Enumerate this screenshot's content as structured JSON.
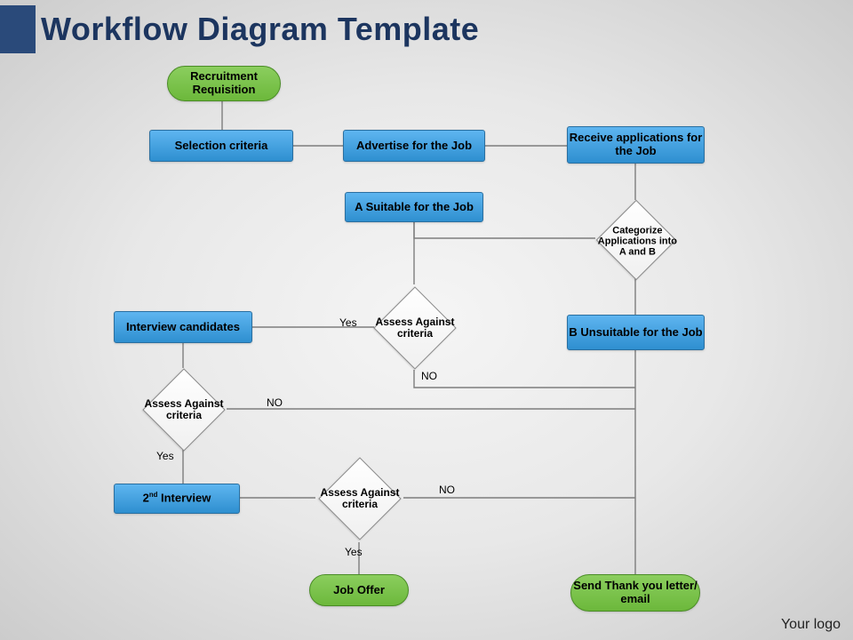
{
  "title": "Workflow Diagram Template",
  "footer": "Your logo",
  "watermark": "",
  "nodes": {
    "start": "Recruitment Requisition",
    "selection": "Selection criteria",
    "advertise": "Advertise for the Job",
    "receive": "Receive applications for the Job",
    "categorize": "Categorize Applications into A and B",
    "suitableA": "A Suitable for the Job",
    "unsuitableB": "B Unsuitable for the Job",
    "assess1": "Assess Against criteria",
    "interview": "Interview candidates",
    "assess2": "Assess Against criteria",
    "second_interview_prefix": "2",
    "second_interview_suffix": " Interview",
    "second_interview_ord": "nd",
    "assess3": "Assess Against criteria",
    "offer": "Job Offer",
    "thankyou": "Send Thank you letter/ email"
  },
  "labels": {
    "yes1": "Yes",
    "no1": "NO",
    "yes2": "Yes",
    "no2": "NO",
    "yes3": "Yes",
    "no3": "NO"
  }
}
